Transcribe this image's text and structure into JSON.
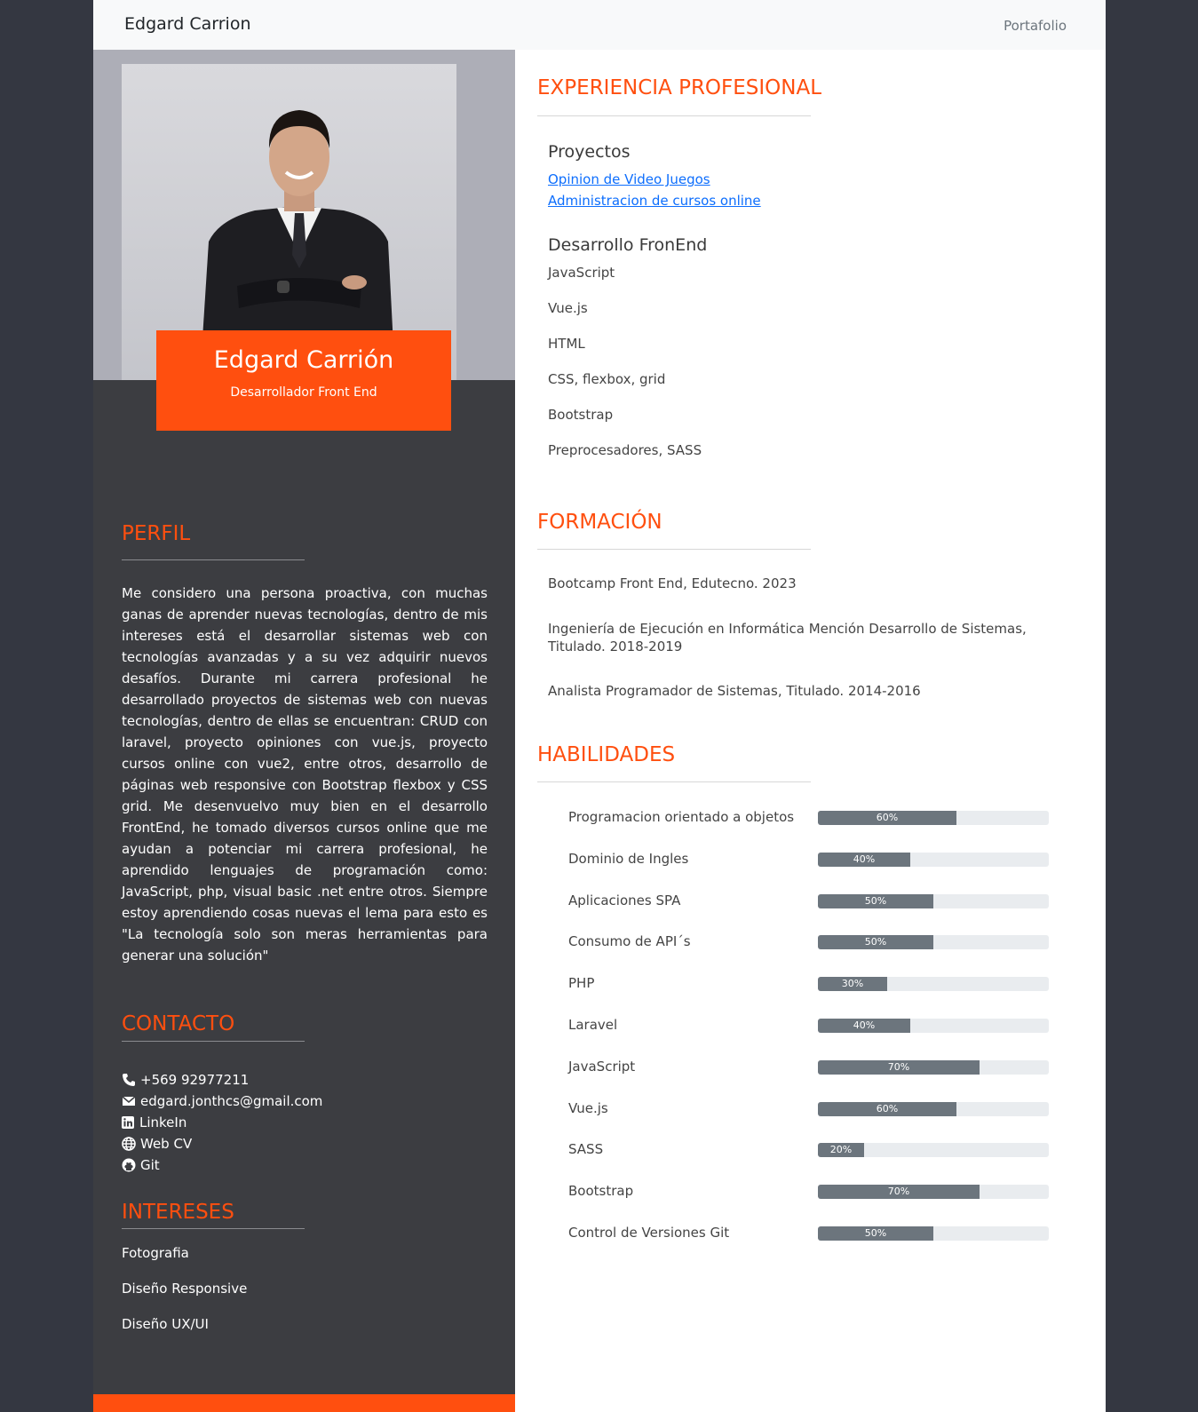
{
  "navbar": {
    "brand": "Edgard Carrion",
    "link": "Portafolio"
  },
  "profile_card": {
    "name": "Edgard Carrión",
    "role": "Desarrollador Front End"
  },
  "left": {
    "perfil_title": "PERFIL",
    "perfil_text": "Me considero una persona proactiva, con muchas ganas de aprender nuevas tecnologías, dentro de mis intereses está el desarrollar sistemas web con tecnologías avanzadas y a su vez adquirir nuevos desafíos. Durante mi carrera profesional he desarrollado proyectos de sistemas web con nuevas tecnologías, dentro de ellas se encuentran: CRUD con laravel, proyecto opiniones con vue.js, proyecto cursos online con vue2, entre otros, desarrollo de páginas web responsive con Bootstrap flexbox y CSS grid. Me desenvuelvo muy bien en el desarrollo FrontEnd, he tomado diversos cursos online que me ayudan a potenciar mi carrera profesional, he aprendido lenguajes de programación como: JavaScript, php, visual basic .net entre otros. Siempre estoy aprendiendo cosas nuevas el lema para esto es \"La tecnología solo son meras herramientas para generar una solución\"",
    "contacto_title": "CONTACTO",
    "contacts": [
      {
        "icon": "phone-icon",
        "text": "+569 92977211"
      },
      {
        "icon": "envelope-icon",
        "text": "edgard.jonthcs@gmail.com"
      },
      {
        "icon": "linkedin-icon",
        "text": "LinkeIn"
      },
      {
        "icon": "globe-icon",
        "text": "Web CV"
      },
      {
        "icon": "github-icon",
        "text": "Git"
      }
    ],
    "intereses_title": "INTERESES",
    "intereses": [
      "Fotografia",
      "Diseño Responsive",
      "Diseño UX/UI"
    ]
  },
  "right": {
    "experiencia_title": "EXPERIENCIA PROFESIONAL",
    "proyectos_title": "Proyectos",
    "proyectos": [
      "Opinion de Video Juegos",
      "Administracion de cursos online"
    ],
    "frontend_title": "Desarrollo FronEnd",
    "frontend": [
      "JavaScript",
      "Vue.js",
      "HTML",
      "CSS, flexbox, grid",
      "Bootstrap",
      "Preprocesadores, SASS"
    ],
    "formacion_title": "FORMACIÓN",
    "formacion": [
      "Bootcamp Front End, Edutecno. 2023",
      "Ingeniería de Ejecución en Informática Mención Desarrollo de Sistemas, Titulado. 2018-2019",
      "Analista Programador de Sistemas, Titulado. 2014-2016"
    ],
    "habilidades_title": "HABILIDADES",
    "skills": [
      {
        "name": "Programacion orientado a objetos",
        "percent": 60,
        "label": "60%"
      },
      {
        "name": "Dominio de Ingles",
        "percent": 40,
        "label": "40%"
      },
      {
        "name": "Aplicaciones SPA",
        "percent": 50,
        "label": "50%"
      },
      {
        "name": "Consumo de API´s",
        "percent": 50,
        "label": "50%"
      },
      {
        "name": "PHP",
        "percent": 30,
        "label": "30%"
      },
      {
        "name": "Laravel",
        "percent": 40,
        "label": "40%"
      },
      {
        "name": "JavaScript",
        "percent": 70,
        "label": "70%"
      },
      {
        "name": "Vue.js",
        "percent": 60,
        "label": "60%"
      },
      {
        "name": "SASS",
        "percent": 20,
        "label": "20%"
      },
      {
        "name": "Bootstrap",
        "percent": 70,
        "label": "70%"
      },
      {
        "name": "Control de Versiones Git",
        "percent": 50,
        "label": "50%"
      }
    ]
  },
  "colors": {
    "accent": "#ff4f0f",
    "sidebar": "#3c3d41",
    "bar": "#6c757d",
    "link": "#0d6efd"
  }
}
